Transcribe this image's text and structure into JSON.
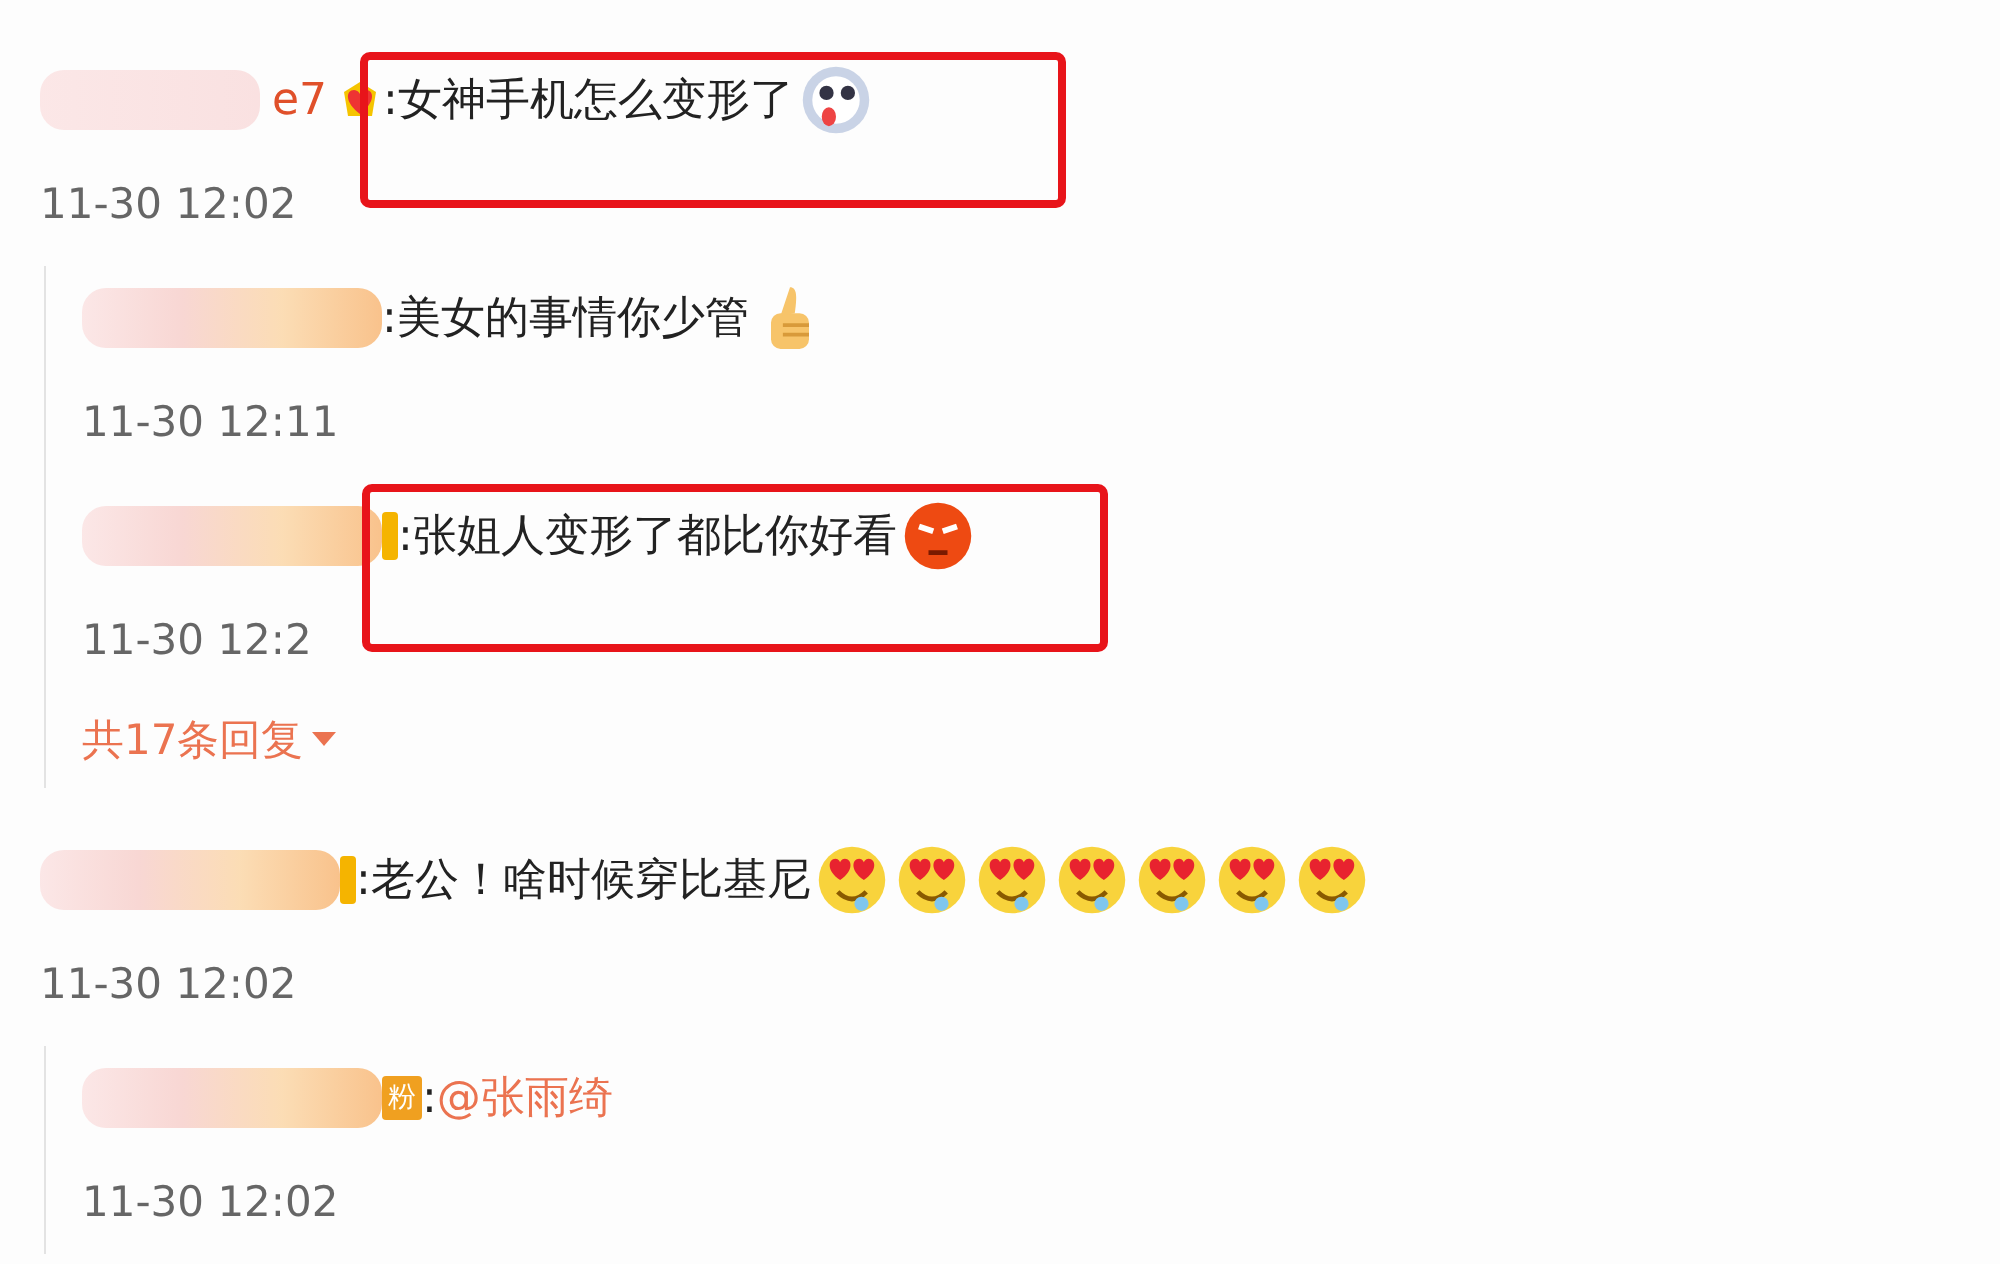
{
  "comments": [
    {
      "name_tail": "e7",
      "badge": {
        "kind": "heart"
      },
      "text": ":女神手机怎么变形了",
      "emojis": [
        {
          "kind": "dog"
        }
      ],
      "time": "11-30 12:02",
      "highlighted": true,
      "replies": [
        {
          "text": ":美女的事情你少管",
          "emojis": [
            {
              "kind": "thumbs"
            }
          ],
          "time": "11-30 12:11",
          "highlighted": false
        },
        {
          "badge": {
            "kind": "partial"
          },
          "text": ":张姐人变形了都比你好看",
          "emojis": [
            {
              "kind": "angry"
            }
          ],
          "time": "11-30 12:2",
          "highlighted": true
        }
      ],
      "more_replies": "共17条回复"
    },
    {
      "badge": {
        "kind": "partial"
      },
      "text": ":老公！啥时候穿比基尼",
      "emojis": [
        {
          "kind": "hearteyes"
        },
        {
          "kind": "hearteyes"
        },
        {
          "kind": "hearteyes"
        },
        {
          "kind": "hearteyes"
        },
        {
          "kind": "hearteyes"
        },
        {
          "kind": "hearteyes"
        },
        {
          "kind": "hearteyes"
        }
      ],
      "time": "11-30 12:02",
      "highlighted": false,
      "replies": [
        {
          "badge": {
            "kind": "fan",
            "label": "粉"
          },
          "text": ":",
          "mention": "@张雨绮",
          "time": "11-30 12:02",
          "highlighted": false
        }
      ]
    }
  ]
}
